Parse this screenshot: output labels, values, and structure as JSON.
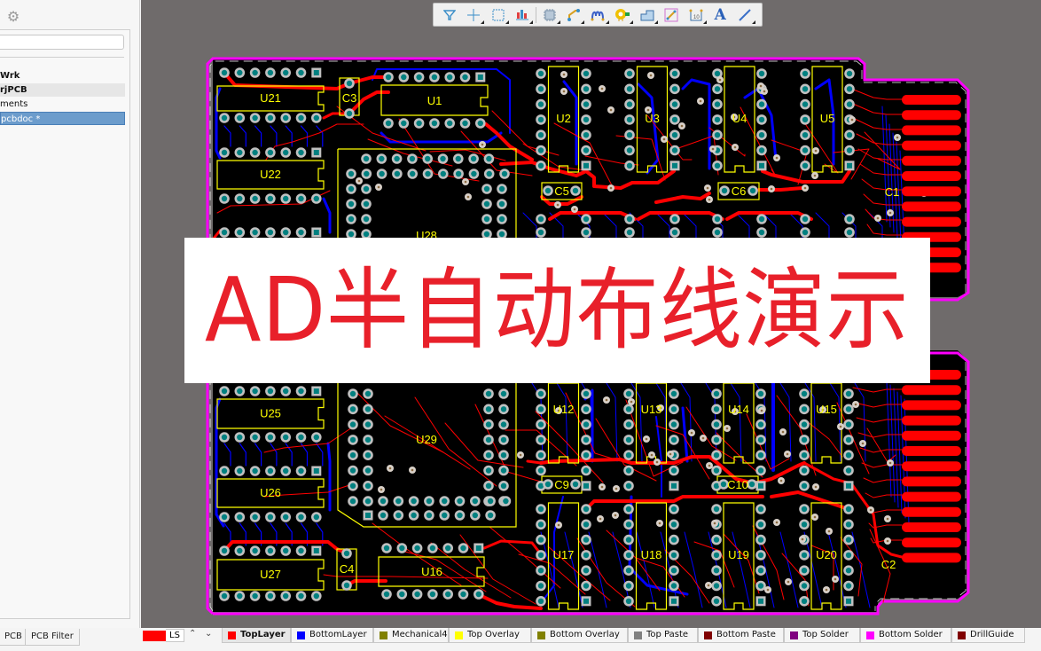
{
  "left_panel": {
    "settings_icon": "gear-icon",
    "search_value": "",
    "tree_items": [
      {
        "label": "Wrk",
        "style": "bold"
      },
      {
        "label": "rjPCB",
        "style": "bold-shade"
      },
      {
        "label": "ments",
        "style": "normal"
      },
      {
        "label": "pcbdoc *",
        "style": "selected"
      }
    ],
    "bottom_tabs": [
      "PCB",
      "PCB Filter"
    ]
  },
  "toolbar": {
    "tools": [
      {
        "icon": "filter-icon",
        "name": "Selection Filter"
      },
      {
        "icon": "move-icon",
        "name": "Move"
      },
      {
        "icon": "select-rect-icon",
        "name": "Select"
      },
      {
        "icon": "align-icon",
        "name": "Align"
      },
      {
        "icon": "component-icon",
        "name": "Place Component"
      },
      {
        "icon": "interactive-route-icon",
        "name": "Interactive Routing"
      },
      {
        "icon": "diff-pair-icon",
        "name": "Differential Pair Routing"
      },
      {
        "icon": "via-pad-icon",
        "name": "Place Via"
      },
      {
        "icon": "polygon-icon",
        "name": "Place Polygon"
      },
      {
        "icon": "net-icon",
        "name": "Place Net"
      },
      {
        "icon": "dimension-icon",
        "name": "Place Dimension"
      },
      {
        "icon": "text-icon",
        "name": "Place String"
      },
      {
        "icon": "line-icon",
        "name": "Place Line"
      }
    ]
  },
  "overlay": {
    "title": "AD半自动布线演示",
    "color": "#e8202a"
  },
  "pcb": {
    "designators": [
      "U21",
      "U22",
      "U25",
      "U26",
      "U27",
      "C3",
      "C4",
      "U1",
      "U16",
      "U28",
      "U29",
      "U2",
      "U3",
      "U4",
      "U5",
      "C5",
      "C6",
      "C1",
      "U12",
      "U13",
      "U14",
      "U15",
      "C9",
      "C10",
      "U17",
      "U18",
      "U19",
      "U20",
      "C2"
    ],
    "colors": {
      "board": "#000000",
      "top_layer": "#ff0000",
      "bottom_layer": "#0000ff",
      "overlay": "#ffff00",
      "outline": "#ff00ff",
      "pad": "#008080",
      "pad_ring": "#c0c0c0",
      "background": "#6f6b6b"
    }
  },
  "layer_bar": {
    "current_layer_label": "LS",
    "current_layer_color": "#ff0000",
    "layers": [
      {
        "name": "TopLayer",
        "color": "#ff0000",
        "active": true
      },
      {
        "name": "BottomLayer",
        "color": "#0000ff",
        "active": false
      },
      {
        "name": "Mechanical4",
        "color": "#808000",
        "active": false
      },
      {
        "name": "Top Overlay",
        "color": "#ffff00",
        "active": false
      },
      {
        "name": "Bottom Overlay",
        "color": "#808000",
        "active": false
      },
      {
        "name": "Top Paste",
        "color": "#808080",
        "active": false
      },
      {
        "name": "Bottom Paste",
        "color": "#800000",
        "active": false
      },
      {
        "name": "Top Solder",
        "color": "#800080",
        "active": false
      },
      {
        "name": "Bottom Solder",
        "color": "#ff00ff",
        "active": false
      },
      {
        "name": "DrillGuide",
        "color": "#800000",
        "active": false
      }
    ]
  }
}
